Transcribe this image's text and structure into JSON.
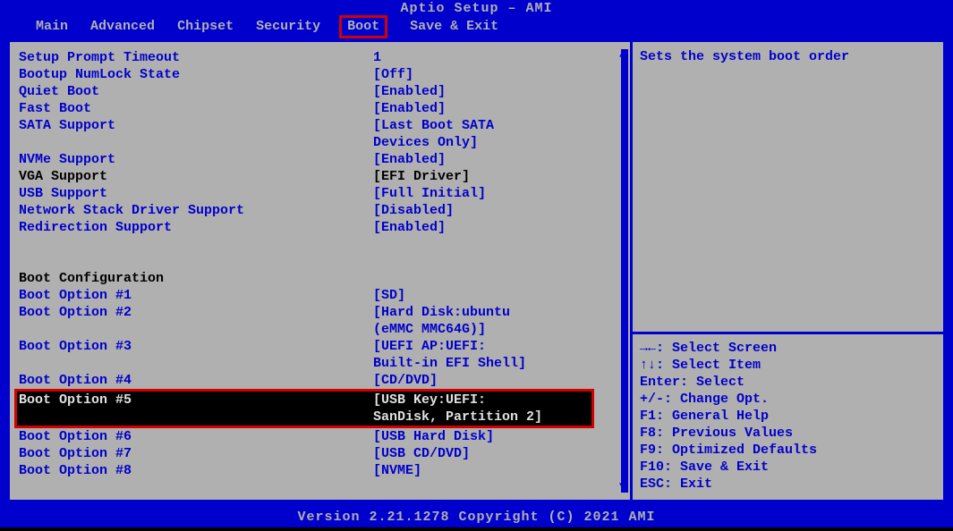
{
  "title": "Aptio Setup – AMI",
  "menus": {
    "main": "Main",
    "advanced": "Advanced",
    "chipset": "Chipset",
    "security": "Security",
    "boot": "Boot",
    "save": "Save & Exit"
  },
  "settings": {
    "prompt_timeout": {
      "label": "Setup Prompt Timeout",
      "value": "1"
    },
    "numlock": {
      "label": "Bootup NumLock State",
      "value": "[Off]"
    },
    "quiet": {
      "label": "Quiet Boot",
      "value": "[Enabled]"
    },
    "fast": {
      "label": "Fast Boot",
      "value": "[Enabled]"
    },
    "sata": {
      "label": " SATA Support",
      "value": "[Last Boot SATA",
      "value2": "Devices Only]"
    },
    "nvme": {
      "label": " NVMe Support",
      "value": "[Enabled]"
    },
    "vga": {
      "label": " VGA Support",
      "value": "[EFI Driver]"
    },
    "usb": {
      "label": " USB Support",
      "value": "[Full Initial]"
    },
    "net": {
      "label": " Network Stack Driver Support",
      "value": "[Disabled]"
    },
    "redir": {
      "label": " Redirection Support",
      "value": "[Enabled]"
    }
  },
  "boot_section": "Boot Configuration",
  "boot_options": {
    "o1": {
      "label": "Boot Option #1",
      "value": "[SD]"
    },
    "o2": {
      "label": "Boot Option #2",
      "value": "[Hard Disk:ubuntu",
      "value2": "(eMMC MMC64G)]"
    },
    "o3": {
      "label": "Boot Option #3",
      "value": "[UEFI AP:UEFI:",
      "value2": "Built-in EFI Shell]"
    },
    "o4": {
      "label": "Boot Option #4",
      "value": "[CD/DVD]"
    },
    "o5": {
      "label": "Boot Option #5",
      "value": "[USB Key:UEFI:",
      "value2": "SanDisk, Partition 2]"
    },
    "o6": {
      "label": "Boot Option #6",
      "value": "[USB Hard Disk]"
    },
    "o7": {
      "label": "Boot Option #7",
      "value": "[USB CD/DVD]"
    },
    "o8": {
      "label": "Boot Option #8",
      "value": "[NVME]"
    }
  },
  "help": {
    "description": "Sets the system boot order",
    "k1": "→←: Select Screen",
    "k2": "↑↓: Select Item",
    "k3": "Enter: Select",
    "k4": "+/-: Change Opt.",
    "k5": "F1: General Help",
    "k6": "F8: Previous Values",
    "k7": "F9: Optimized Defaults",
    "k8": "F10: Save & Exit",
    "k9": "ESC: Exit"
  },
  "footer": "Version 2.21.1278 Copyright (C) 2021 AMI"
}
